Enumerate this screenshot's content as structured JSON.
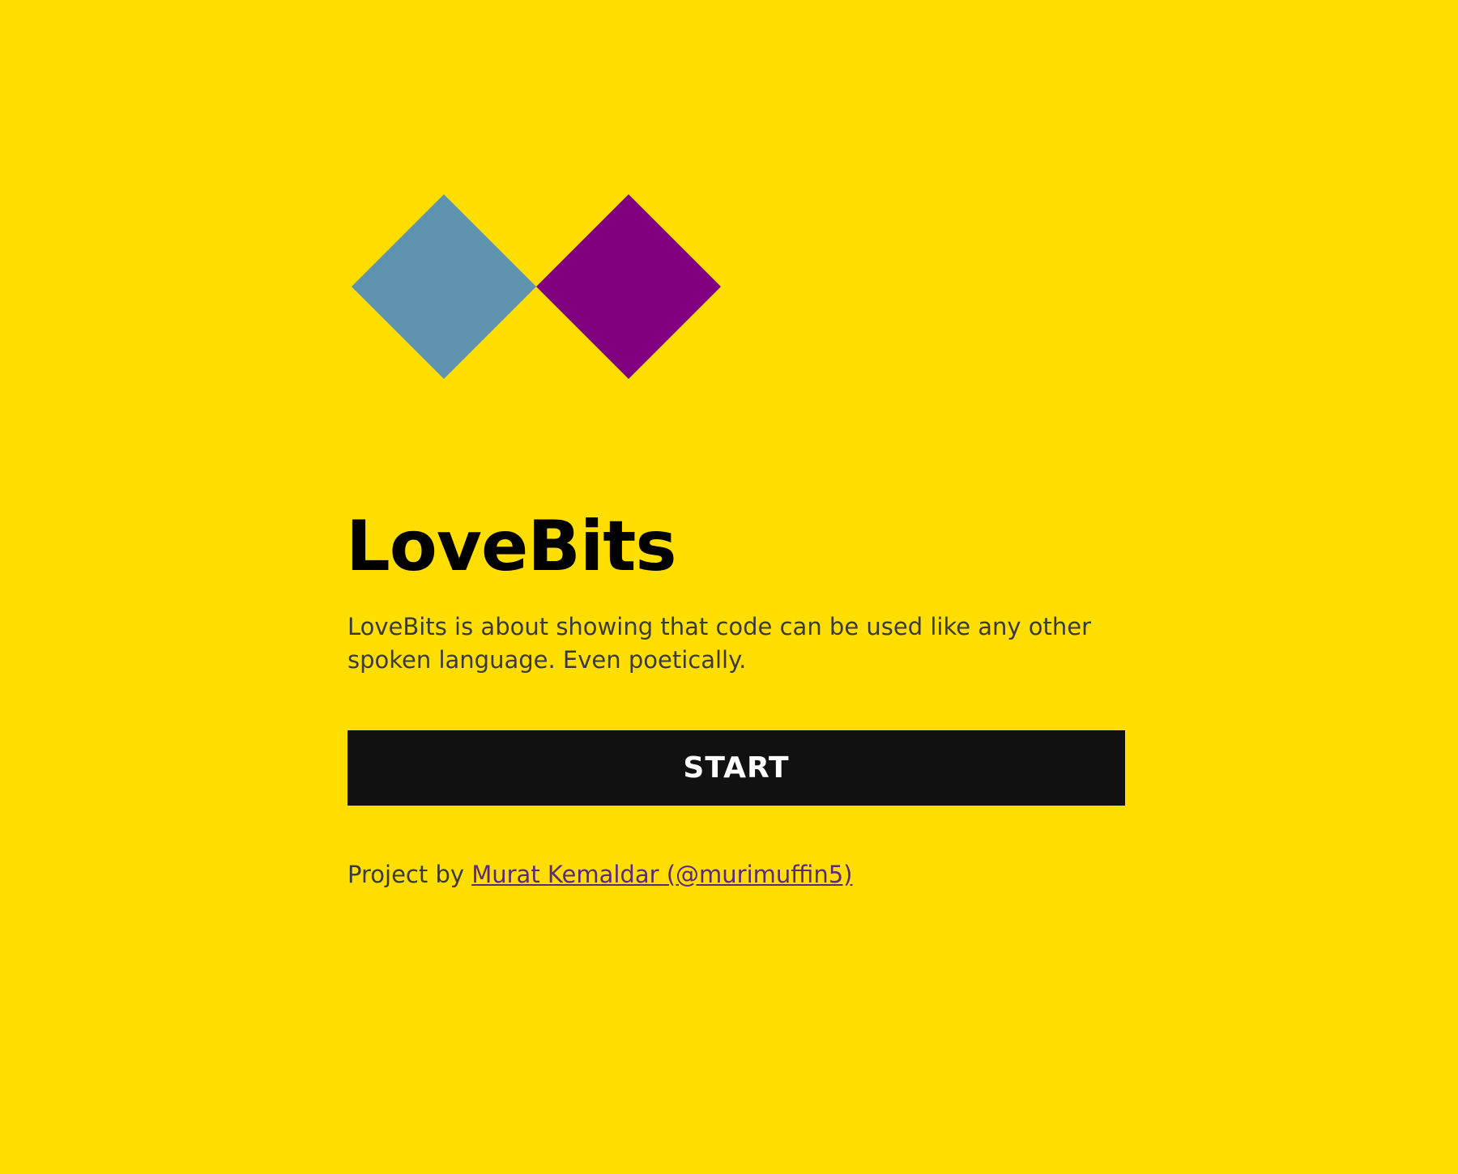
{
  "colors": {
    "background": "#FFDE00",
    "diamond_left": "#5E94B0",
    "diamond_right": "#800080",
    "title": "#000000",
    "body_text": "#3a3a3a",
    "button_bg": "#111111",
    "button_text": "#ffffff",
    "link": "#5a2a82"
  },
  "logo": {
    "icon_left": "blue-diamond-icon",
    "icon_right": "purple-diamond-icon"
  },
  "title": "LoveBits",
  "description": "LoveBits is about showing that code can be used like any other spoken language. Even poetically.",
  "start_button": {
    "label": "START"
  },
  "credit": {
    "prefix": "Project by",
    "link_text": "Murat Kemaldar (@murimuffin5)"
  }
}
